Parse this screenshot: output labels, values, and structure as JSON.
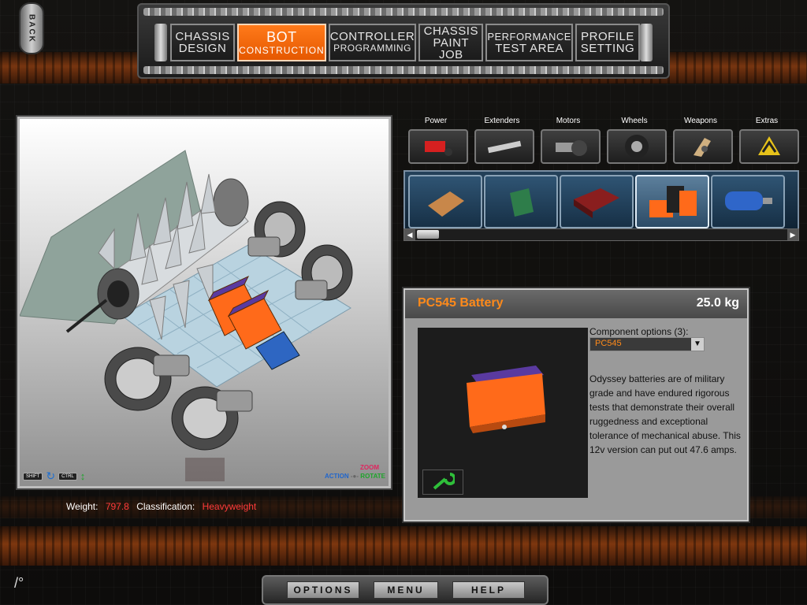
{
  "nav": {
    "back": "BACK",
    "tabs": [
      {
        "line1": "CHASSIS",
        "line2": "DESIGN"
      },
      {
        "line1": "BOT",
        "line2": "CONSTRUCTION"
      },
      {
        "line1": "CONTROLLER",
        "line2": "PROGRAMMING"
      },
      {
        "line1": "CHASSIS",
        "line2": "PAINT JOB"
      },
      {
        "line1": "PERFORMANCE",
        "line2": "TEST AREA"
      },
      {
        "line1": "PROFILE",
        "line2": "SETTING"
      }
    ],
    "active_tab": 1
  },
  "viewport": {
    "shift_key": "SHIFT",
    "ctrl_key": "CTRL",
    "action_label": "ACTION",
    "zoom_label": "ZOOM",
    "rotate_label": "ROTATE"
  },
  "stats": {
    "weight_label": "Weight:",
    "weight_value": "797.8",
    "classification_label": "Classification:",
    "classification_value": "Heavyweight"
  },
  "categories": [
    "Power",
    "Extenders",
    "Motors",
    "Wheels",
    "Weapons",
    "Extras"
  ],
  "component_icons": [
    "controller-board-icon",
    "circuit-board-icon",
    "speed-controller-icon",
    "battery-pack-icon",
    "puma-motor-icon"
  ],
  "selected_component": 3,
  "component": {
    "name": "PC545 Battery",
    "weight": "25.0 kg",
    "options_label": "Component options (3):",
    "option_value": "PC545",
    "description": "Odyssey batteries are of military grade and have endured rigorous tests that demonstrate their overall ruggedness and exceptional tolerance of mechanical abuse.  This 12v version can put out 47.6 amps."
  },
  "menu": {
    "options": "OPTIONS",
    "menu": "MENU",
    "help": "HELP"
  },
  "colors": {
    "accent": "#ff7a1a",
    "warning": "#ff3a3a"
  }
}
